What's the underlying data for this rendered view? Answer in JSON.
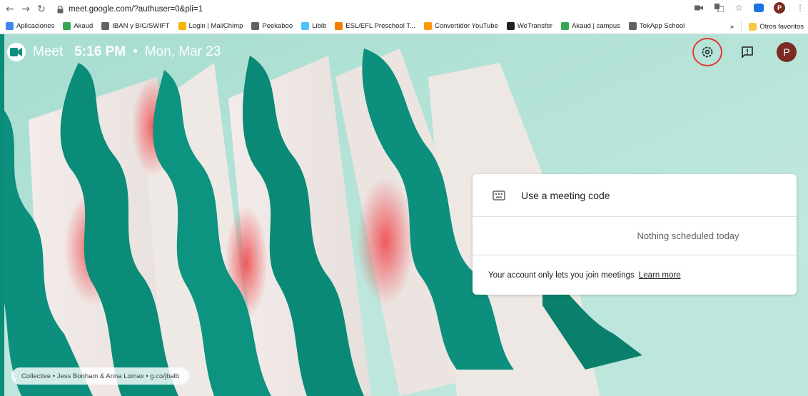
{
  "browser": {
    "url": "meet.google.com/?authuser=0&pli=1",
    "bookmarks": [
      {
        "label": "Aplicaciones",
        "color": "#4285f4"
      },
      {
        "label": "Akaud",
        "color": "#34a853"
      },
      {
        "label": "IBAN y BIC/SWIFT",
        "color": "#5f6368"
      },
      {
        "label": "Login | MailChimp",
        "color": "#f4b400"
      },
      {
        "label": "Peekaboo",
        "color": "#5f6368"
      },
      {
        "label": "Libib",
        "color": "#4fc3f7"
      },
      {
        "label": "ESL/EFL Preschool T...",
        "color": "#f57c00"
      },
      {
        "label": "Convertidor YouTube",
        "color": "#ff9800"
      },
      {
        "label": "WeTransfer",
        "color": "#202124"
      },
      {
        "label": "Akaud | campus",
        "color": "#34a853"
      },
      {
        "label": "TokApp School",
        "color": "#5f6368"
      }
    ],
    "more_bookmarks": "»",
    "other_favorites": "Otros favoritos",
    "profile_initial": "P"
  },
  "header": {
    "app_name": "Meet",
    "time": "5:16 PM",
    "separator": "•",
    "date": "Mon, Mar 23",
    "avatar_initial": "P"
  },
  "card": {
    "meeting_code_label": "Use a meeting code",
    "schedule_text": "Nothing scheduled today",
    "account_notice": "Your account only lets you join meetings",
    "learn_more": "Learn more"
  },
  "credit": {
    "text": "Collective • Jess Bonham & Anna Lomax • g.co/jbalb"
  },
  "colors": {
    "background_mint": "#b6e4d8",
    "teal": "#0d8f7d",
    "accent_red": "#e53935",
    "avatar": "#7b2b23"
  }
}
